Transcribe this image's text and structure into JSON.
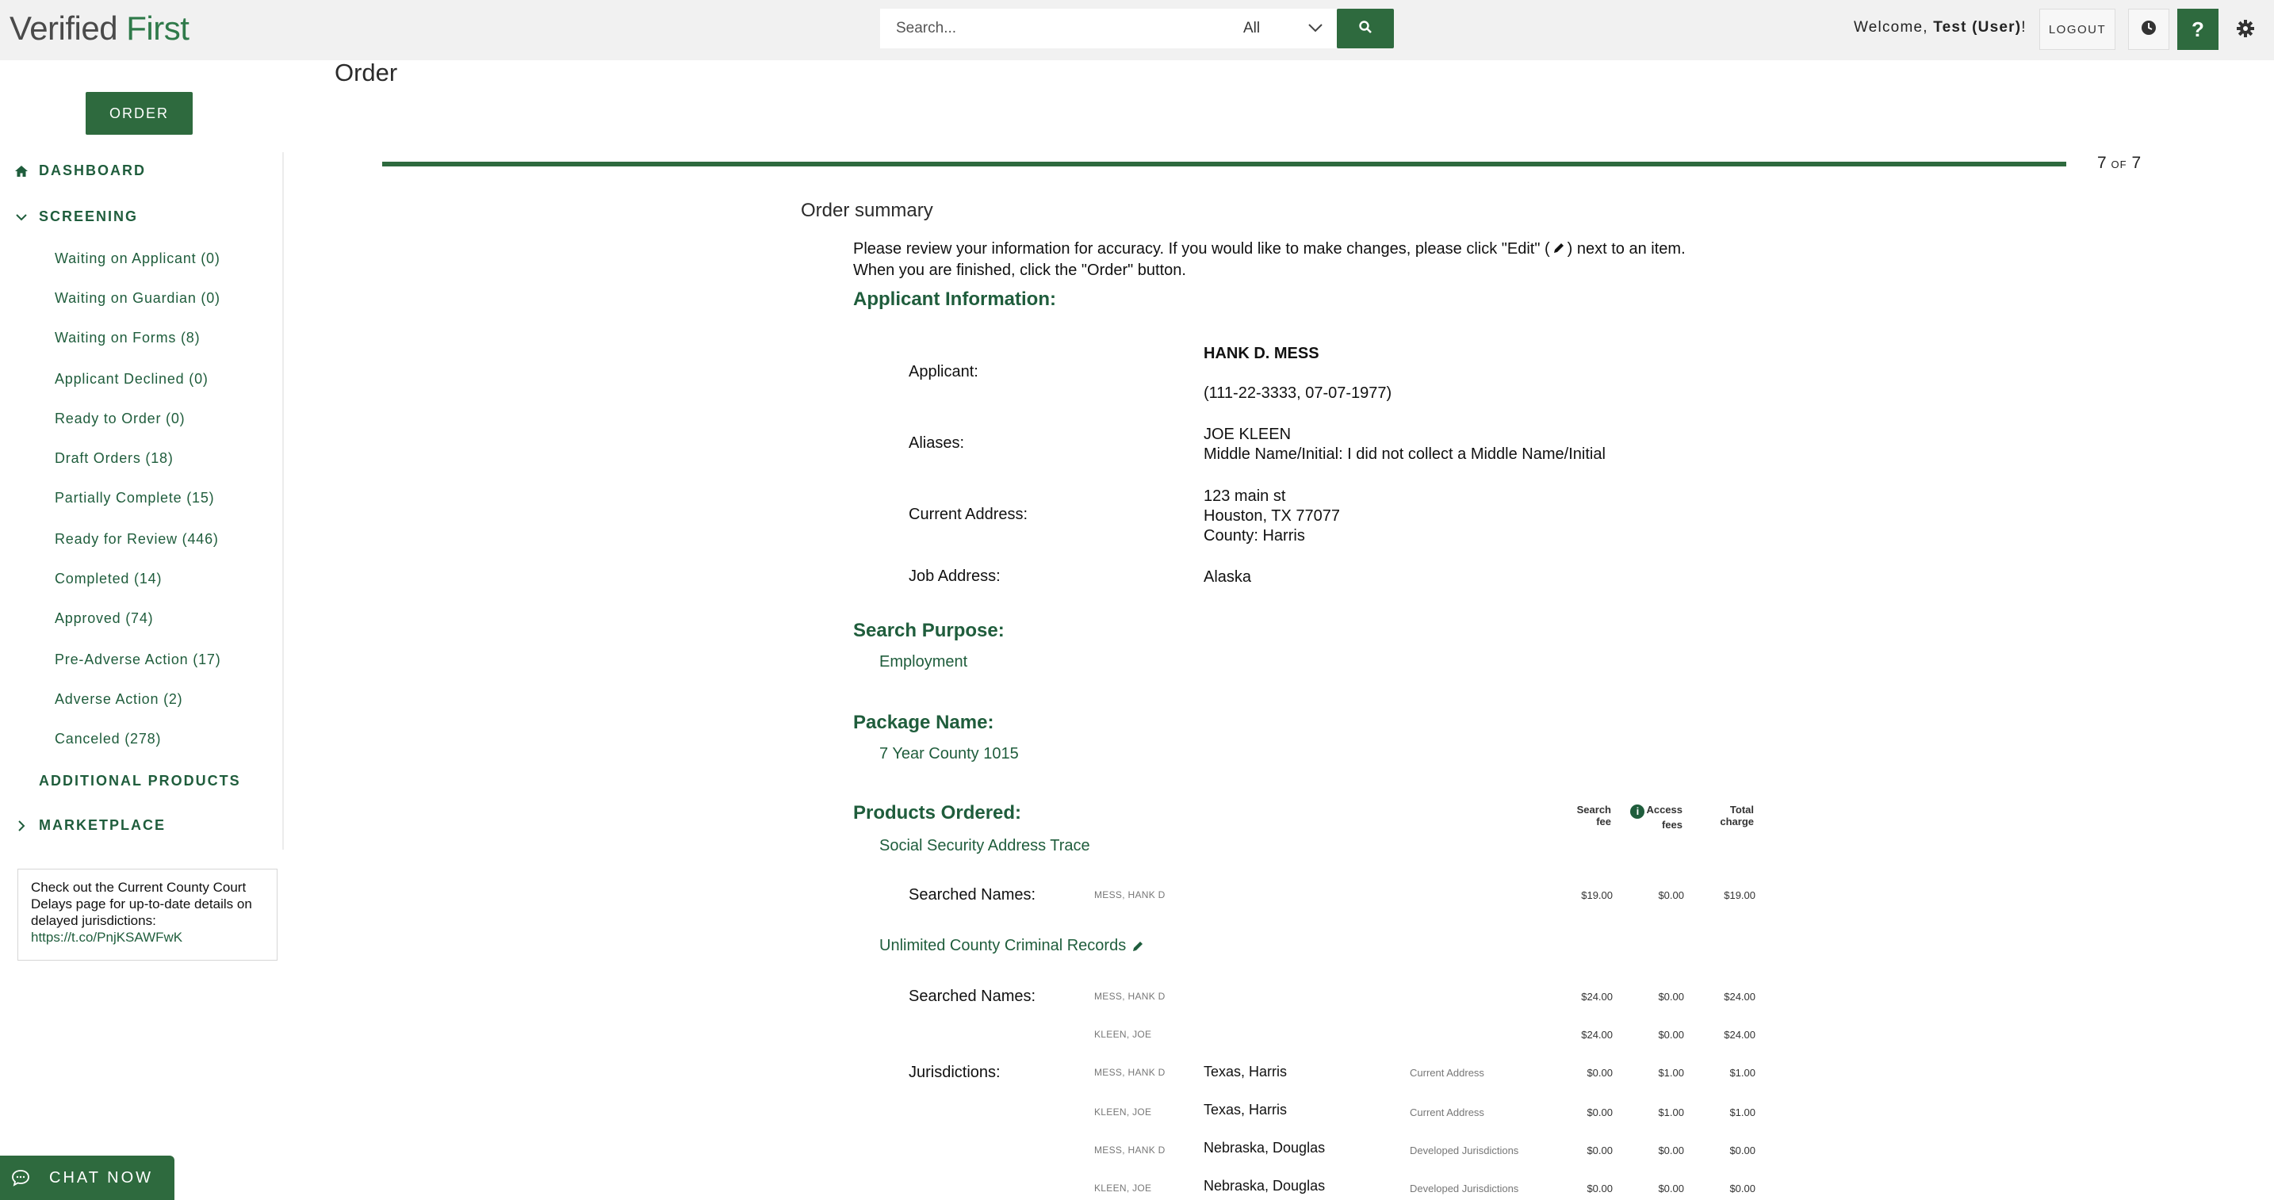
{
  "header": {
    "logo_part1": "Verified",
    "logo_part2": "First",
    "search_placeholder": "Search...",
    "search_scope": "All",
    "welcome_prefix": "Welcome,",
    "welcome_user": "Test (User)",
    "welcome_suffix": "!",
    "logout_label": "LOGOUT",
    "help_label": "?"
  },
  "sidebar": {
    "order_label": "ORDER",
    "dashboard_label": "DASHBOARD",
    "screening_label": "SCREENING",
    "screening_items": [
      "Waiting on Applicant (0)",
      "Waiting on Guardian (0)",
      "Waiting on Forms (8)",
      "Applicant Declined (0)",
      "Ready to Order (0)",
      "Draft Orders (18)",
      "Partially Complete (15)",
      "Ready for Review (446)",
      "Completed (14)",
      "Approved (74)",
      "Pre-Adverse Action (17)",
      "Adverse Action (2)",
      "Canceled (278)"
    ],
    "additional_products_label": "ADDITIONAL PRODUCTS",
    "marketplace_label": "MARKETPLACE",
    "notice_text": "Check out the Current County Court Delays page for up-to-date details on delayed jurisdictions:",
    "notice_link": "https://t.co/PnjKSAWFwK",
    "chat_label": "CHAT NOW"
  },
  "main": {
    "page_title": "Order",
    "step_current": "7",
    "step_of": "OF",
    "step_total": "7",
    "summary_heading": "Order summary",
    "instructions_line1": "Please review your information for accuracy. If you would like to make changes, please click \"Edit\" (",
    "instructions_line1_end": ") next to an item.",
    "instructions_line2": "When you are finished, click the \"Order\" button.",
    "applicant_heading": "Applicant Information:",
    "applicant_label": "Applicant:",
    "applicant_name": "HANK D. MESS",
    "applicant_ids": "(111-22-3333, 07-07-1977)",
    "aliases_label": "Aliases:",
    "alias_name": "JOE KLEEN",
    "alias_middle": "Middle Name/Initial: I did not collect a Middle Name/Initial",
    "current_address_label": "Current Address:",
    "address_line1": "123 main st",
    "address_line2": "Houston, TX 77077",
    "address_county": "County: Harris",
    "job_address_label": "Job Address:",
    "job_address": "Alaska",
    "search_purpose_heading": "Search Purpose:",
    "search_purpose": "Employment",
    "package_heading": "Package Name:",
    "package_name": "7 Year County 1015",
    "products_heading": "Products Ordered:",
    "fee_headers": {
      "search_fee_1": "Search",
      "search_fee_2": "fee",
      "access_fees_1": "Access",
      "access_fees_2": "fees",
      "total_1": "Total",
      "total_2": "charge",
      "info_glyph": "i"
    },
    "product1_name": "Social Security Address Trace",
    "product2_name": "Unlimited County Criminal Records",
    "searched_names_label": "Searched Names:",
    "jurisdictions_label": "Jurisdictions:",
    "product1_rows": [
      {
        "name": "MESS, HANK D",
        "search": "$19.00",
        "access": "$0.00",
        "total": "$19.00"
      }
    ],
    "product2_name_rows": [
      {
        "name": "MESS, HANK D",
        "search": "$24.00",
        "access": "$0.00",
        "total": "$24.00"
      },
      {
        "name": "KLEEN, JOE",
        "search": "$24.00",
        "access": "$0.00",
        "total": "$24.00"
      }
    ],
    "jurisdiction_rows": [
      {
        "name": "MESS, HANK D",
        "jurisdiction": "Texas, Harris",
        "type": "Current Address",
        "search": "$0.00",
        "access": "$1.00",
        "total": "$1.00"
      },
      {
        "name": "KLEEN, JOE",
        "jurisdiction": "Texas, Harris",
        "type": "Current Address",
        "search": "$0.00",
        "access": "$1.00",
        "total": "$1.00"
      },
      {
        "name": "MESS, HANK D",
        "jurisdiction": "Nebraska, Douglas",
        "type": "Developed Jurisdictions",
        "search": "$0.00",
        "access": "$0.00",
        "total": "$0.00"
      },
      {
        "name": "KLEEN, JOE",
        "jurisdiction": "Nebraska, Douglas",
        "type": "Developed Jurisdictions",
        "search": "$0.00",
        "access": "$0.00",
        "total": "$0.00"
      }
    ]
  }
}
